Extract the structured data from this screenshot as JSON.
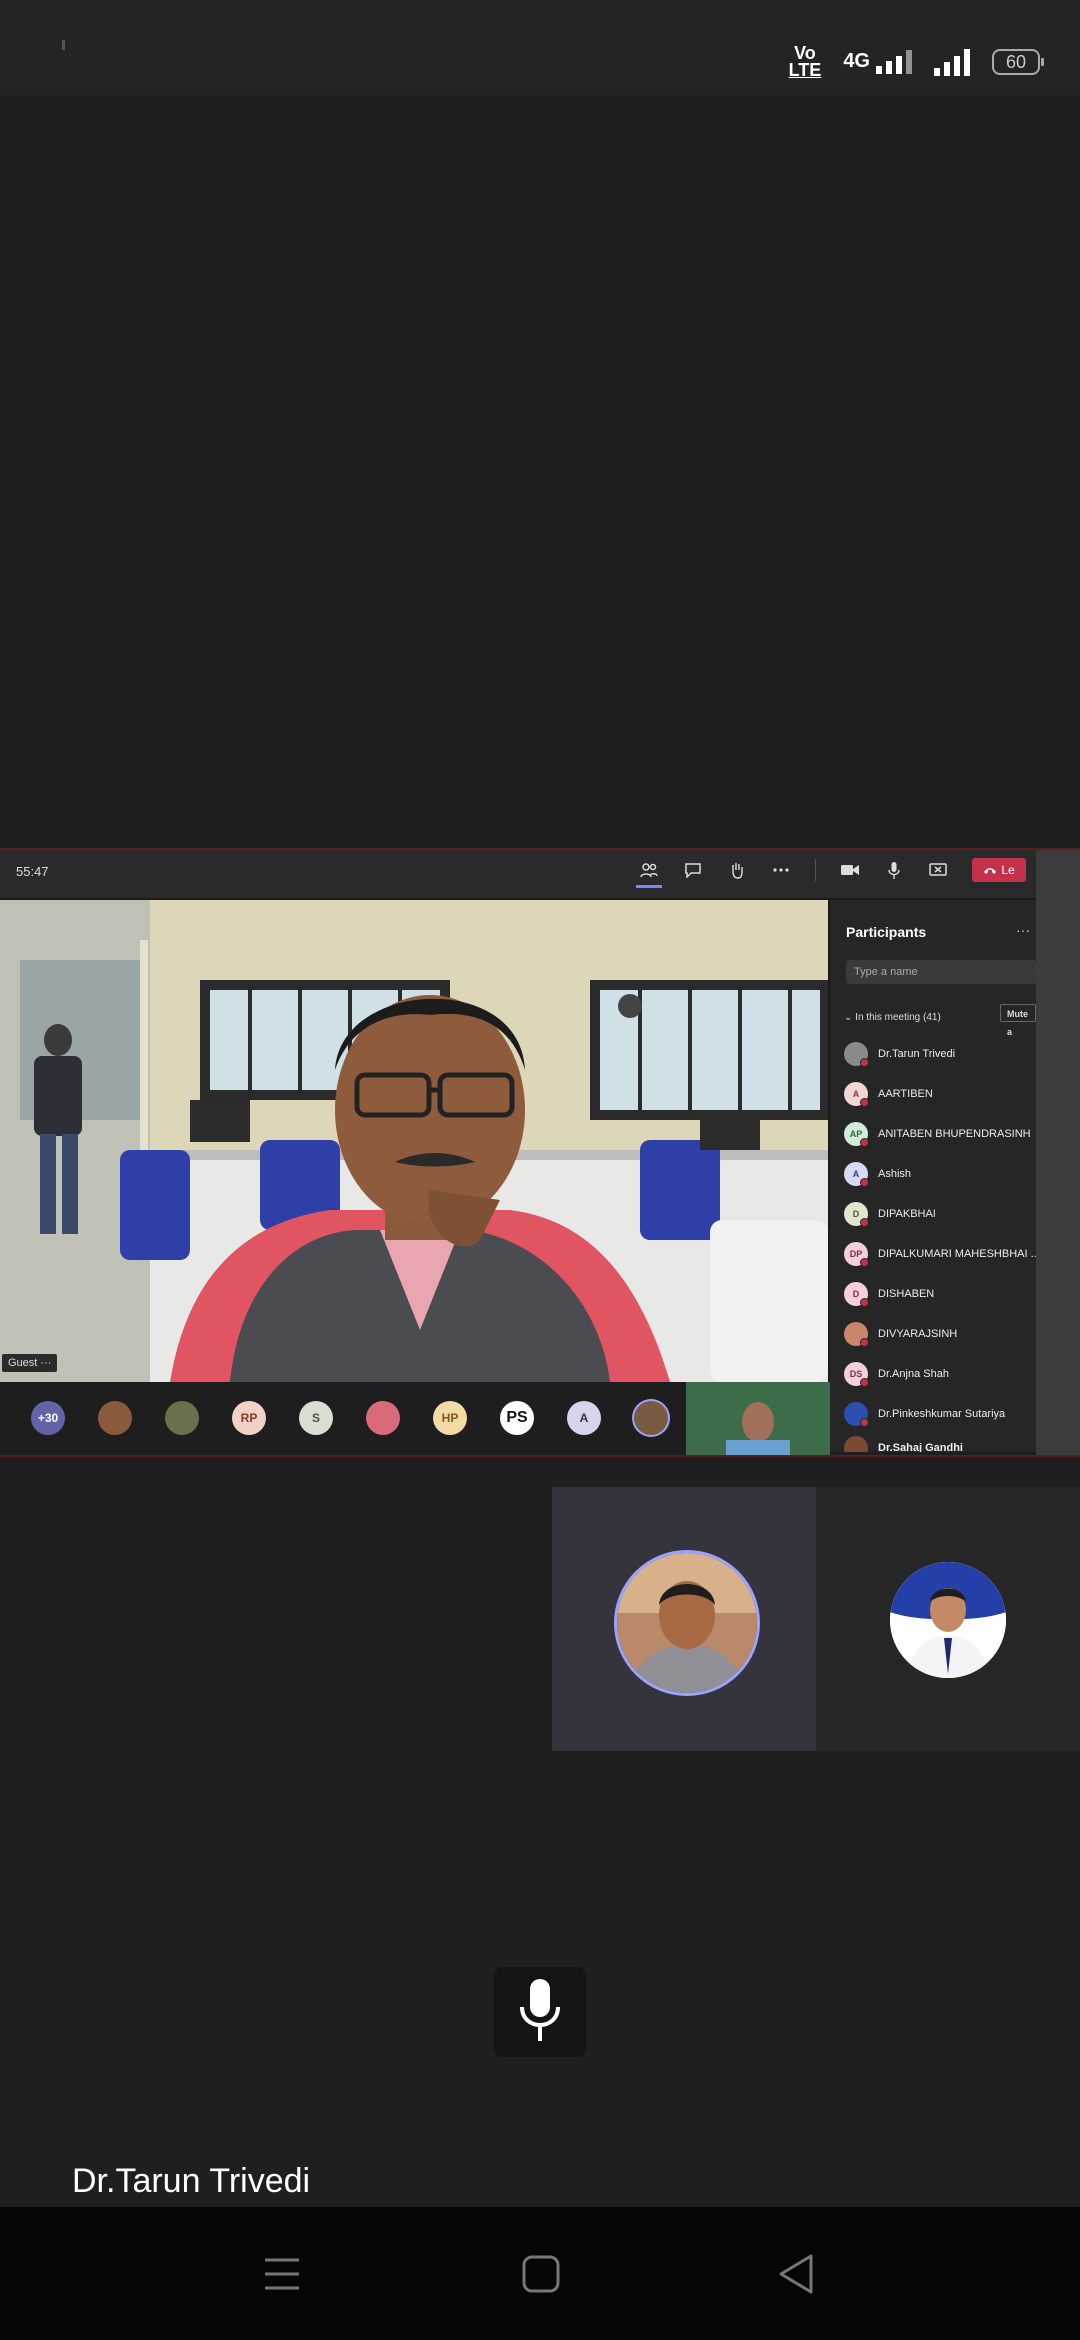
{
  "status_bar": {
    "volte_line1": "Vo",
    "volte_line2": "LTE",
    "network": "4G",
    "battery": "60"
  },
  "meeting": {
    "timer": "55:47",
    "leave_label": "Le",
    "guest_label": "Guest",
    "more_glyph": "···",
    "overflow_count": "+30",
    "strip_avatars": [
      {
        "initials": "",
        "color": "#8a5a3c"
      },
      {
        "initials": "",
        "color": "#6b6f4a"
      },
      {
        "initials": "RP",
        "color": "#f2d2c8"
      },
      {
        "initials": "S",
        "color": "#d6dfd1"
      },
      {
        "initials": "",
        "color": "#d96a7a"
      },
      {
        "initials": "HP",
        "color": "#f3dba8"
      },
      {
        "initials": "PS",
        "color": "#ffffff"
      },
      {
        "initials": "A",
        "color": "#d5d6ee"
      },
      {
        "initials": "",
        "color": "#7a5a40"
      }
    ]
  },
  "participants_panel": {
    "title": "Participants",
    "search_placeholder": "Type a name",
    "section_label": "In this meeting (41)",
    "mute_all_label": "Mute a",
    "items": [
      {
        "name": "Dr.Tarun Trivedi",
        "initials": "",
        "color": "#888"
      },
      {
        "name": "AARTIBEN",
        "initials": "A",
        "color": "#f3d6d6"
      },
      {
        "name": "ANITABEN BHUPENDRASINH",
        "initials": "AP",
        "color": "#d3ecd9"
      },
      {
        "name": "Ashish",
        "initials": "A",
        "color": "#d6daf3"
      },
      {
        "name": "DIPAKBHAI",
        "initials": "D",
        "color": "#e3e6cf"
      },
      {
        "name": "DIPALKUMARI MAHESHBHAI ...",
        "initials": "DP",
        "color": "#f3d1dc"
      },
      {
        "name": "DISHABEN",
        "initials": "D",
        "color": "#f3d1dc"
      },
      {
        "name": "DIVYARAJSINH",
        "initials": "",
        "color": "#c9866a"
      },
      {
        "name": "Dr.Anjna Shah",
        "initials": "DS",
        "color": "#f3d1dc"
      },
      {
        "name": "Dr.Pinkeshkumar Sutariya",
        "initials": "",
        "color": "#2b4fb0"
      },
      {
        "name": "Dr.Sahaj Gandhi",
        "initials": "",
        "color": "#7a4a35"
      }
    ]
  },
  "active_speaker": {
    "name": "Dr.Tarun Trivedi"
  }
}
